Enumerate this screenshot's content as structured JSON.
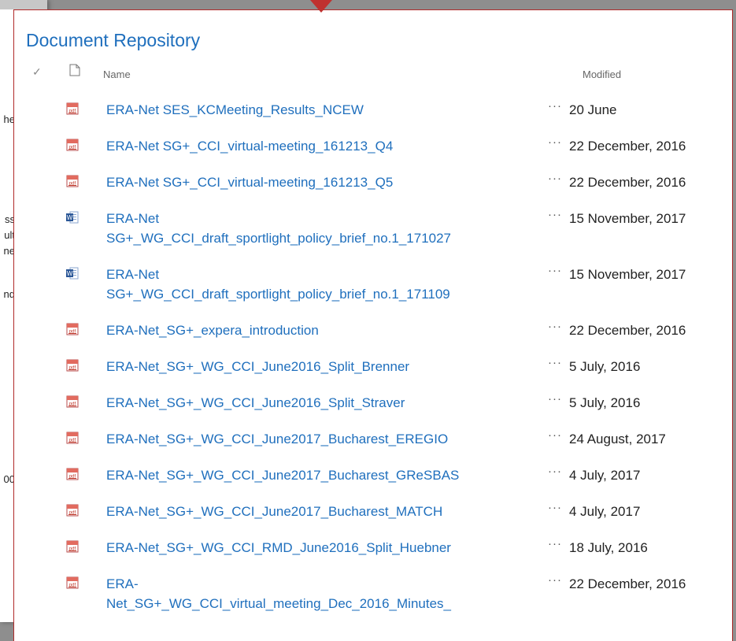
{
  "library": {
    "title": "Document Repository",
    "columns": {
      "name": "Name",
      "modified": "Modified"
    },
    "more_glyph": "···",
    "files": [
      {
        "type": "pdf",
        "name": "ERA-Net SES_KCMeeting_Results_NCEW",
        "modified": "20 June"
      },
      {
        "type": "pdf",
        "name": "ERA-Net SG+_CCI_virtual-meeting_161213_Q4",
        "modified": "22 December, 2016"
      },
      {
        "type": "pdf",
        "name": "ERA-Net SG+_CCI_virtual-meeting_161213_Q5",
        "modified": "22 December, 2016"
      },
      {
        "type": "word",
        "name": "ERA-Net\nSG+_WG_CCI_draft_sportlight_policy_brief_no.1_171027",
        "modified": "15 November, 2017"
      },
      {
        "type": "word",
        "name": "ERA-Net\nSG+_WG_CCI_draft_sportlight_policy_brief_no.1_171109",
        "modified": "15 November, 2017"
      },
      {
        "type": "pdf",
        "name": "ERA-Net_SG+_expera_introduction",
        "modified": "22 December, 2016"
      },
      {
        "type": "pdf",
        "name": "ERA-Net_SG+_WG_CCI_June2016_Split_Brenner",
        "modified": "5 July, 2016"
      },
      {
        "type": "pdf",
        "name": "ERA-Net_SG+_WG_CCI_June2016_Split_Straver",
        "modified": "5 July, 2016"
      },
      {
        "type": "pdf",
        "name": "ERA-Net_SG+_WG_CCI_June2017_Bucharest_EREGIO",
        "modified": "24 August, 2017"
      },
      {
        "type": "pdf",
        "name": "ERA-Net_SG+_WG_CCI_June2017_Bucharest_GReSBAS",
        "modified": "4 July, 2017"
      },
      {
        "type": "pdf",
        "name": "ERA-Net_SG+_WG_CCI_June2017_Bucharest_MATCH",
        "modified": "4 July, 2017"
      },
      {
        "type": "pdf",
        "name": "ERA-Net_SG+_WG_CCI_RMD_June2016_Split_Huebner",
        "modified": "18 July, 2016"
      },
      {
        "type": "pdf",
        "name": "ERA-\nNet_SG+_WG_CCI_virtual_meeting_Dec_2016_Minutes_",
        "modified": "22 December, 2016"
      }
    ]
  },
  "background_fragments": [
    "he",
    "ss",
    "ult",
    "ne",
    "nd",
    "00"
  ]
}
